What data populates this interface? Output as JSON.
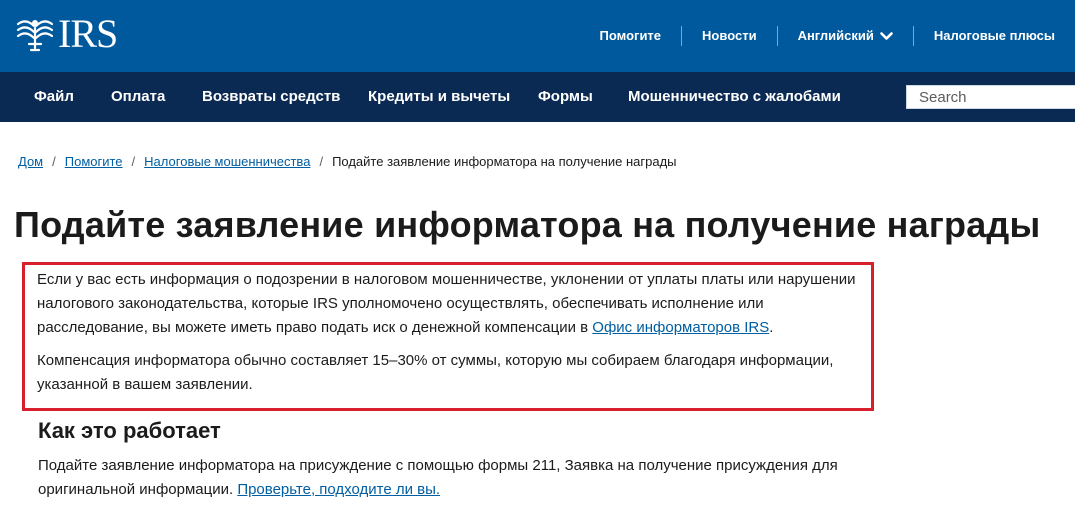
{
  "header": {
    "logo_text": "IRS",
    "utility_nav": [
      {
        "label": "Помогите"
      },
      {
        "label": "Новости"
      },
      {
        "label": "Английский"
      },
      {
        "label": "Налоговые плюсы"
      }
    ]
  },
  "main_nav": [
    {
      "label": "Файл"
    },
    {
      "label": "Оплата"
    },
    {
      "label": "Возвраты средств"
    },
    {
      "label": "Кредиты и вычеты"
    },
    {
      "label": "Формы"
    },
    {
      "label": "Мошенничество с жалобами"
    }
  ],
  "search": {
    "placeholder": "Search"
  },
  "breadcrumb": [
    {
      "label": "Дом"
    },
    {
      "label": "Помогите"
    },
    {
      "label": "Налоговые мошенничества"
    },
    {
      "label": "Подайте заявление информатора на получение награды"
    }
  ],
  "page_title": "Подайте заявление информатора на получение награды",
  "intro": {
    "p1_text": "Если у вас есть информация о подозрении в налоговом мошенничестве, уклонении от уплаты платы или нарушении налогового законодательства, которые IRS уполномочено осуществлять, обеспечивать исполнение или расследование, вы можете иметь право подать иск о денежной компенсации в ",
    "p1_link": "Офис информаторов IRS",
    "p1_end": ".",
    "p2_text": "Компенсация информатора обычно составляет 15–30% от суммы, которую мы собираем благодаря информации, указанной в вашем заявлении."
  },
  "how_it_works": {
    "title": "Как это работает",
    "text": "Подайте заявление информатора на присуждение с помощью формы 211, Заявка на получение присуждения для оригинальной информации. ",
    "link": "Проверьте, подходите ли вы."
  },
  "colors": {
    "top_bar": "#00599c",
    "main_nav": "#0b2a53",
    "link": "#005ea2",
    "highlight_border": "#d6202e"
  }
}
